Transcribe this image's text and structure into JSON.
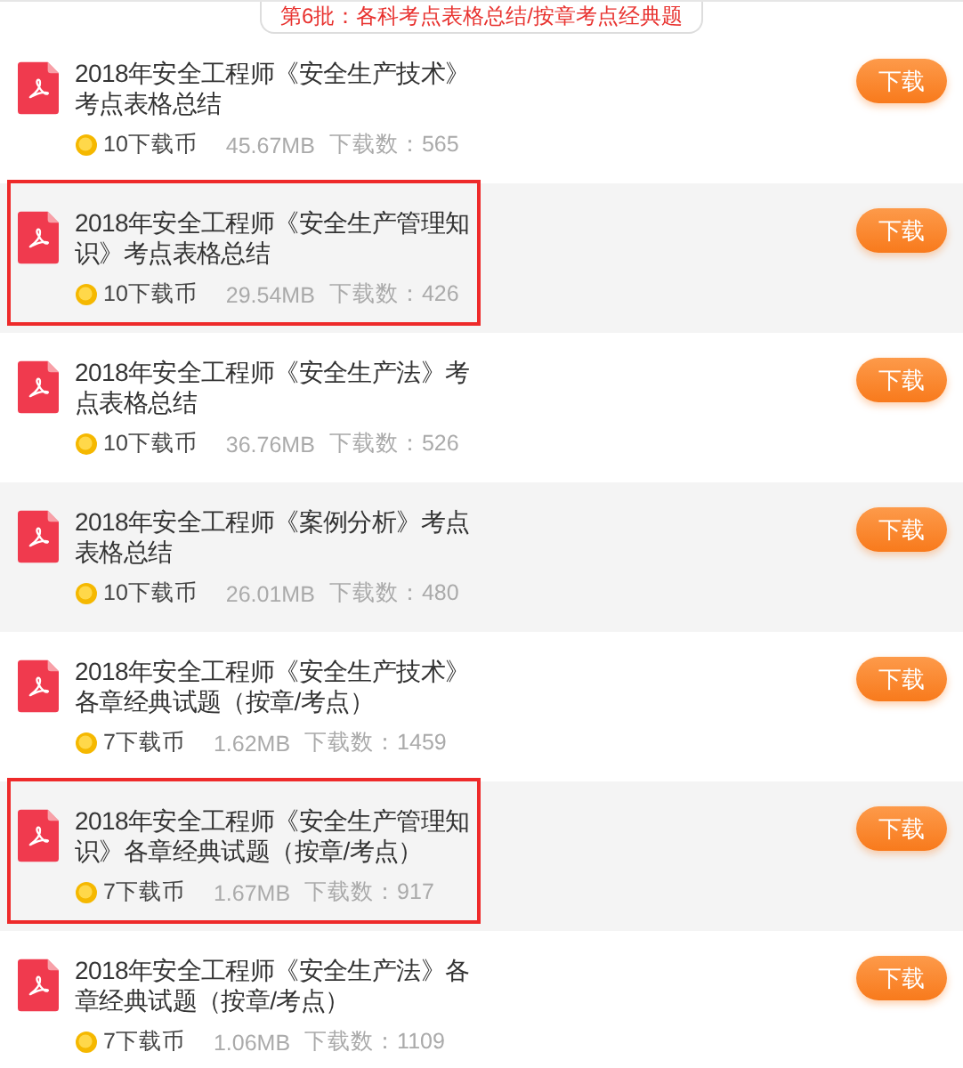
{
  "header": {
    "label": "第6批：各科考点表格总结/按章考点经典题"
  },
  "items": [
    {
      "title": "2018年安全工程师《安全生产技术》考点表格总结",
      "price": "10下载币",
      "size": "45.67MB",
      "downloads": "下载数：565",
      "highlighted": false,
      "button": "下载"
    },
    {
      "title": "2018年安全工程师《安全生产管理知识》考点表格总结",
      "price": "10下载币",
      "size": "29.54MB",
      "downloads": "下载数：426",
      "highlighted": true,
      "button": "下载"
    },
    {
      "title": "2018年安全工程师《安全生产法》考点表格总结",
      "price": "10下载币",
      "size": "36.76MB",
      "downloads": "下载数：526",
      "highlighted": false,
      "button": "下载"
    },
    {
      "title": "2018年安全工程师《案例分析》考点表格总结",
      "price": "10下载币",
      "size": "26.01MB",
      "downloads": "下载数：480",
      "highlighted": false,
      "button": "下载"
    },
    {
      "title": "2018年安全工程师《安全生产技术》各章经典试题（按章/考点）",
      "price": "7下载币",
      "size": "1.62MB",
      "downloads": "下载数：1459",
      "highlighted": false,
      "button": "下载"
    },
    {
      "title": "2018年安全工程师《安全生产管理知识》各章经典试题（按章/考点）",
      "price": "7下载币",
      "size": "1.67MB",
      "downloads": "下载数：917",
      "highlighted": true,
      "button": "下载"
    },
    {
      "title": "2018年安全工程师《安全生产法》各章经典试题（按章/考点）",
      "price": "7下载币",
      "size": "1.06MB",
      "downloads": "下载数：1109",
      "highlighted": false,
      "button": "下载"
    }
  ]
}
